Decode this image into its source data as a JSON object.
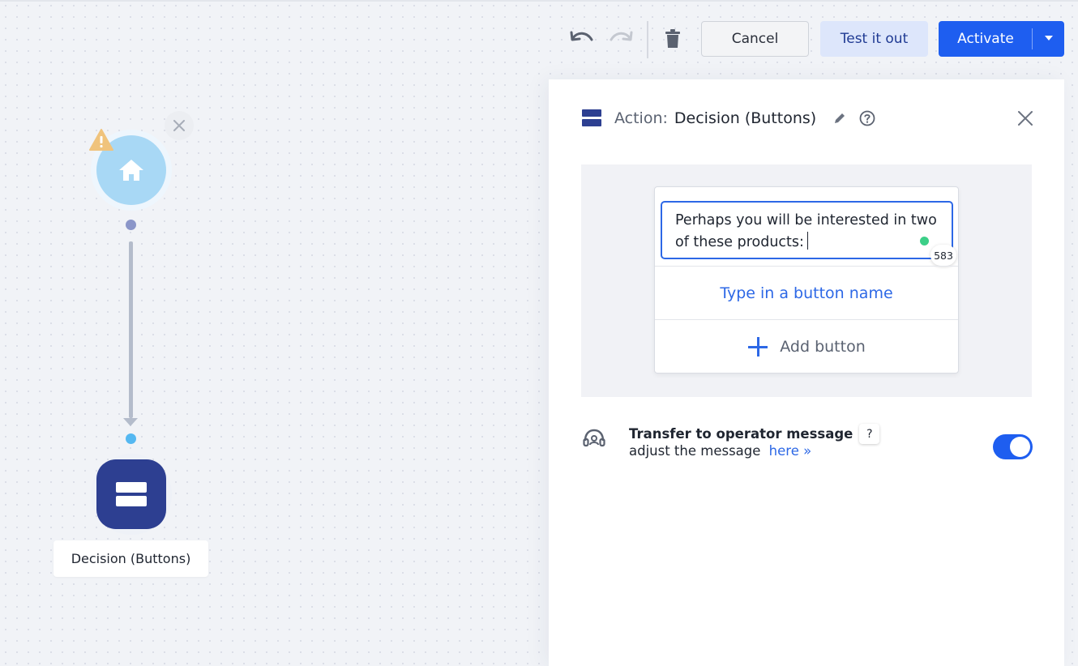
{
  "toolbar": {
    "undo_icon": "undo-icon",
    "redo_icon": "redo-icon",
    "delete_icon": "trash-icon",
    "cancel_label": "Cancel",
    "test_label": "Test it out",
    "activate_label": "Activate"
  },
  "canvas": {
    "start_node_icon": "home-icon",
    "start_node_warning_icon": "warning-icon",
    "decision_node_label": "Decision (Buttons)"
  },
  "panel": {
    "action_label": "Action:",
    "action_title": "Decision (Buttons)",
    "message_text": "Perhaps you will be interested in two of these products:",
    "char_counter": "583",
    "button_placeholder": "Type in a button name",
    "add_button_label": "Add button",
    "transfer": {
      "title": "Transfer to operator message",
      "help_label": "?",
      "subtitle": "adjust the message",
      "link_label": "here »",
      "enabled": true
    }
  },
  "colors": {
    "accent": "#1e5ef0",
    "decision_node": "#2d3f91",
    "start_node": "#a8d8f5",
    "status_dot": "#3ccf88"
  }
}
